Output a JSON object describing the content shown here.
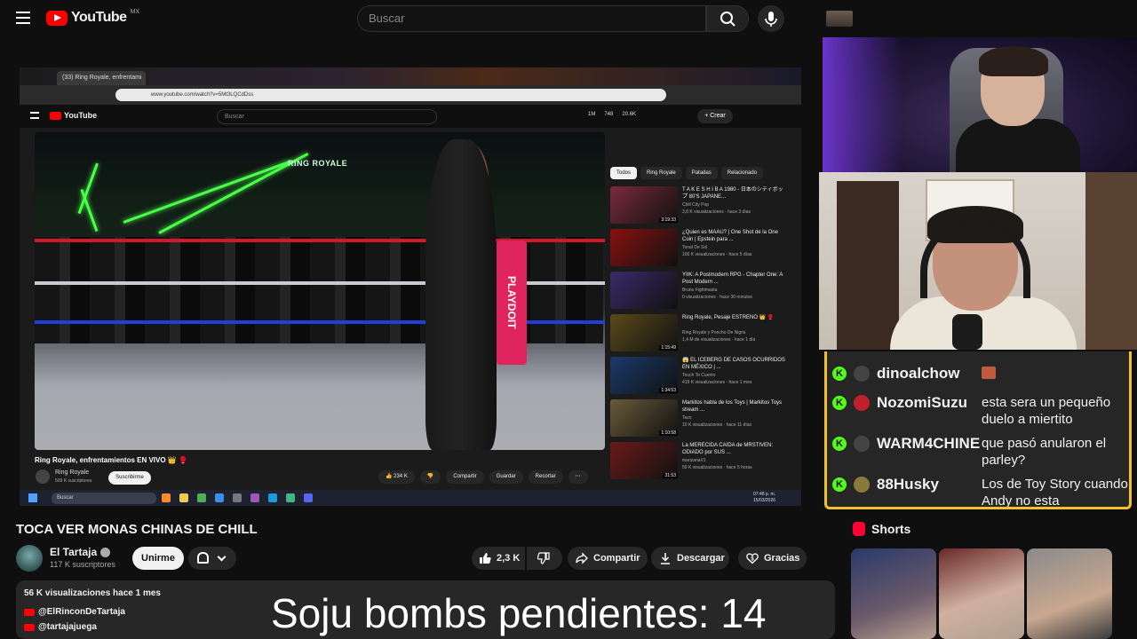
{
  "header": {
    "logo_text": "YouTube",
    "country": "MX",
    "search_placeholder": "Buscar"
  },
  "screen": {
    "tab_title": "(33) Ring Royale, enfrentami",
    "address": "www.youtube.com/watch?v=5Mt3LQCdDss",
    "inner_search_placeholder": "Buscar",
    "inner_logo_text": "YouTube",
    "stats": [
      "1M",
      "748",
      "20.6K"
    ],
    "create_label": "+ Crear",
    "video_logo": "RING ROYALE",
    "banner_text": "PLAYDOIT",
    "video_title": "Ring Royale, enfrentamientos EN VIVO 👑 🥊",
    "channel": "Ring Royale",
    "channel_subs": "509 K suscriptores",
    "subscribe_label": "Suscribirme",
    "actions": [
      "👍 234 K",
      "👎",
      "Compartir",
      "Guardar",
      "Recortar",
      "⋯"
    ],
    "chips": [
      {
        "label": "Todos",
        "active": true
      },
      {
        "label": "Ring Royale",
        "active": false
      },
      {
        "label": "Patadas",
        "active": false
      },
      {
        "label": "Relacionado",
        "active": false
      }
    ],
    "recommendations": [
      {
        "title": "T A K E S H I B A 1980 - 日本のシティポップ 80'S JAPANE...",
        "channel": "Chill City Pop",
        "views": "3,8 K visualizaciones · hace 3 días",
        "duration": "3:19:33",
        "color": "#7a2a3a"
      },
      {
        "title": "¿Quien es MAAU? | One Shot de la One Coin | Epstein para ...",
        "channel": "Tonal De Sol",
        "views": "100 K visualizaciones · hace 5 días",
        "duration": "",
        "color": "#8a1010"
      },
      {
        "title": "YIIK: A Postmodern RPG - Chapter One: A Post Modern ...",
        "channel": "Bruno Fightmasta",
        "views": "0 visualizaciones · hace 30 minutos",
        "duration": "",
        "color": "#3a2a6a"
      },
      {
        "title": "Ring Royale, Pesaje ESTRENO 👑 🥊",
        "channel": "Ring Royale y Poncho De Nigris",
        "views": "1,4 M de visualizaciones · hace 1 día",
        "duration": "1:15:49",
        "color": "#5a4a1a"
      },
      {
        "title": "😱 EL ICEBERG DE CASOS OCURRIDOS EN MÉXICO | ...",
        "channel": "Touch Te Cuento",
        "views": "419 K visualizaciones · hace 1 mes",
        "duration": "1:34:53",
        "color": "#1a3a6a"
      },
      {
        "title": "Markitos habla de los Toys | Markitos Toys stream ...",
        "channel": "Tavo",
        "views": "10 K visualizaciones · hace 11 días",
        "duration": "1:10:58",
        "color": "#6a5a3a"
      },
      {
        "title": "La MERECIDA CAÍDA de MRSTIVEN: ODIADO por SUS ...",
        "channel": "manzanaV1",
        "views": "59 K visualizaciones · hace 5 horas",
        "duration": "31:53",
        "color": "#6a1a1a"
      }
    ],
    "taskbar_search": "Buscar",
    "clock": "07:48 p. m.",
    "date": "15/03/2026"
  },
  "chat": {
    "messages": [
      {
        "user": "dinoalchow",
        "text": "",
        "badge": "K"
      },
      {
        "user": "NozomiSuzu",
        "text": "esta sera un pequeño duelo a miertito",
        "badge": "K"
      },
      {
        "user": "WARM4CHINE",
        "text": "que pasó anularon el parley?",
        "badge": "K"
      },
      {
        "user": "88Husky",
        "text": "Los de Toy Story cuando Andy no esta",
        "badge": "K"
      }
    ],
    "border_color": "#f5c12a"
  },
  "shorts": {
    "title": "Shorts"
  },
  "video": {
    "title": "TOCA VER MONAS CHINAS DE CHILL",
    "channel": "El Tartaja",
    "subscribers": "117 K suscriptores",
    "join_label": "Unirme",
    "likes": "2,3 K",
    "share_label": "Compartir",
    "download_label": "Descargar",
    "thanks_label": "Gracias",
    "description_meta": "56 K visualizaciones  hace 1 mes",
    "links": [
      "@ElRinconDeTartaja",
      "@tartajajuega"
    ],
    "overlay": "Soju bombs pendientes: 14"
  }
}
